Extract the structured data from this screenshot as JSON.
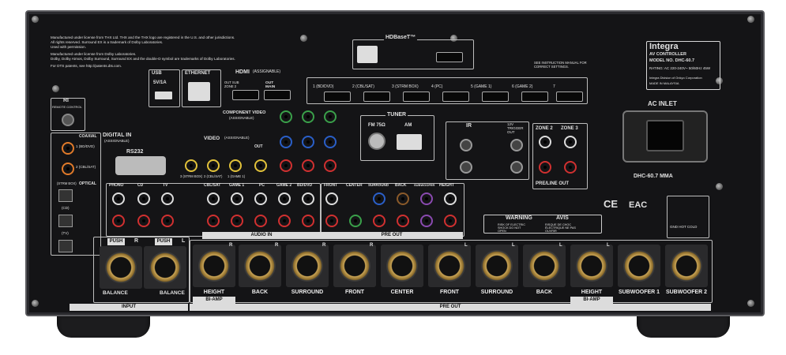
{
  "brand": {
    "name": "Integra",
    "subtitle": "AV CONTROLLER",
    "model": "MODEL NO. DHC-60.7",
    "rating": "RATING: AC 220-240V~ 50/60Hz 45W",
    "maker": "Integra Division of Onkyo Corporation",
    "origin": "MADE IN MALAYSIA",
    "see_manual": "SEE INSTRUCTION MANUAL FOR CORRECT SETTINGS.",
    "model_plate": "DHC-60.7 MMA"
  },
  "license": {
    "line1": "Manufactured under license from THX Ltd. THX and the THX logo are registered in the U.S. and other jurisdictions.",
    "line2": "All rights reserved. Surround EX is a trademark of Dolby Laboratories.",
    "line3": "Used with permission.",
    "line4": "Manufactured under license from Dolby Laboratories.",
    "line5": "Dolby, Dolby Atmos, Dolby Surround, Surround EX and the double-D symbol are trademarks of Dolby Laboratories.",
    "line6": "For DTS patents, see http://patents.dts.com."
  },
  "sections": {
    "hdbaset": "HDBaseT™",
    "usb": "USB",
    "usb_rating": "5V/1A",
    "ethernet": "ETHERNET",
    "hdmi": "HDMI",
    "hdmi_sub": "(ASSIGNABLE)",
    "out_sub": "OUT SUB ZONE 2",
    "out_main": "OUT MAIN",
    "ri": "RI",
    "remote_control": "REMOTE CONTROL",
    "digital_in": "DIGITAL IN",
    "digital_sub": "(ASSIGNABLE)",
    "coaxial": "COAXIAL",
    "optical": "OPTICAL",
    "rs232": "RS232",
    "component_video": "COMPONENT VIDEO",
    "component_sub": "(ASSIGNABLE)",
    "video": "VIDEO",
    "video_sub": "(ASSIGNABLE)",
    "tuner": "TUNER",
    "fm": "FM 75Ω",
    "am": "AM",
    "ir": "IR",
    "trigger_out": "12V TRIGGER OUT",
    "zone2": "ZONE 2",
    "zone3": "ZONE 3",
    "pre_line_out": "PRE/LINE OUT",
    "ac_inlet": "AC INLET",
    "audio_in": "AUDIO IN",
    "pre_out_mid": "PRE OUT",
    "input": "INPUT",
    "pre_out_bottom": "PRE OUT",
    "warning": "WARNING",
    "avis": "AVIS",
    "warning_text": "RISK OF ELECTRIC SHOCK DO NOT OPEN",
    "avis_text": "RISQUE DE CHOC ÉLECTRIQUE NE PAS OUVRIR",
    "cert": "CE",
    "eac": "EAC",
    "gnd_hot_cold": "GND HOT COLD"
  },
  "hdmi_inputs": [
    "1 (BD/DVD)",
    "2 (CBL/SAT)",
    "3 (STRM BOX)",
    "4 (PC)",
    "5 (GAME 1)",
    "6 (GAME 2)",
    "7"
  ],
  "digital_inputs": {
    "coax": [
      "1 (BD/DVD)",
      "2 (CBL/SAT)"
    ],
    "opt": [
      "(STRM BOX)",
      "(CD)",
      "(TV)"
    ]
  },
  "audio_in_labels": [
    "PHONO",
    "CD",
    "TV",
    "CBL/SAT",
    "GAME 1",
    "PC",
    "GAME 2",
    "BD/DVD"
  ],
  "pre_out_mid_labels": [
    "FRONT",
    "CENTER",
    "SURROUND",
    "BACK",
    "SUBWOOFER",
    "HEIGHT"
  ],
  "video_labels": [
    "3 (STRM BOX)",
    "2 (CBL/SAT)",
    "1 (GAME 1)",
    "OUT"
  ],
  "balanced_in": {
    "push": "PUSH",
    "r": "R",
    "l": "L",
    "label": "BALANCE"
  },
  "xlr_outputs": [
    {
      "label": "HEIGHT",
      "ch": "R"
    },
    {
      "label": "BACK",
      "ch": "R"
    },
    {
      "label": "SURROUND",
      "ch": "R"
    },
    {
      "label": "FRONT",
      "ch": "R"
    },
    {
      "label": "CENTER",
      "ch": ""
    },
    {
      "label": "FRONT",
      "ch": "L"
    },
    {
      "label": "SURROUND",
      "ch": "L"
    },
    {
      "label": "BACK",
      "ch": "L"
    },
    {
      "label": "HEIGHT",
      "ch": "L"
    },
    {
      "label": "SUBWOOFER 1",
      "ch": ""
    },
    {
      "label": "SUBWOOFER 2",
      "ch": ""
    }
  ],
  "bi_amp": "BI-AMP",
  "colors": {
    "chassis": "#141416",
    "gold": "#c9a455",
    "label_bar": "#dcdcdc"
  }
}
